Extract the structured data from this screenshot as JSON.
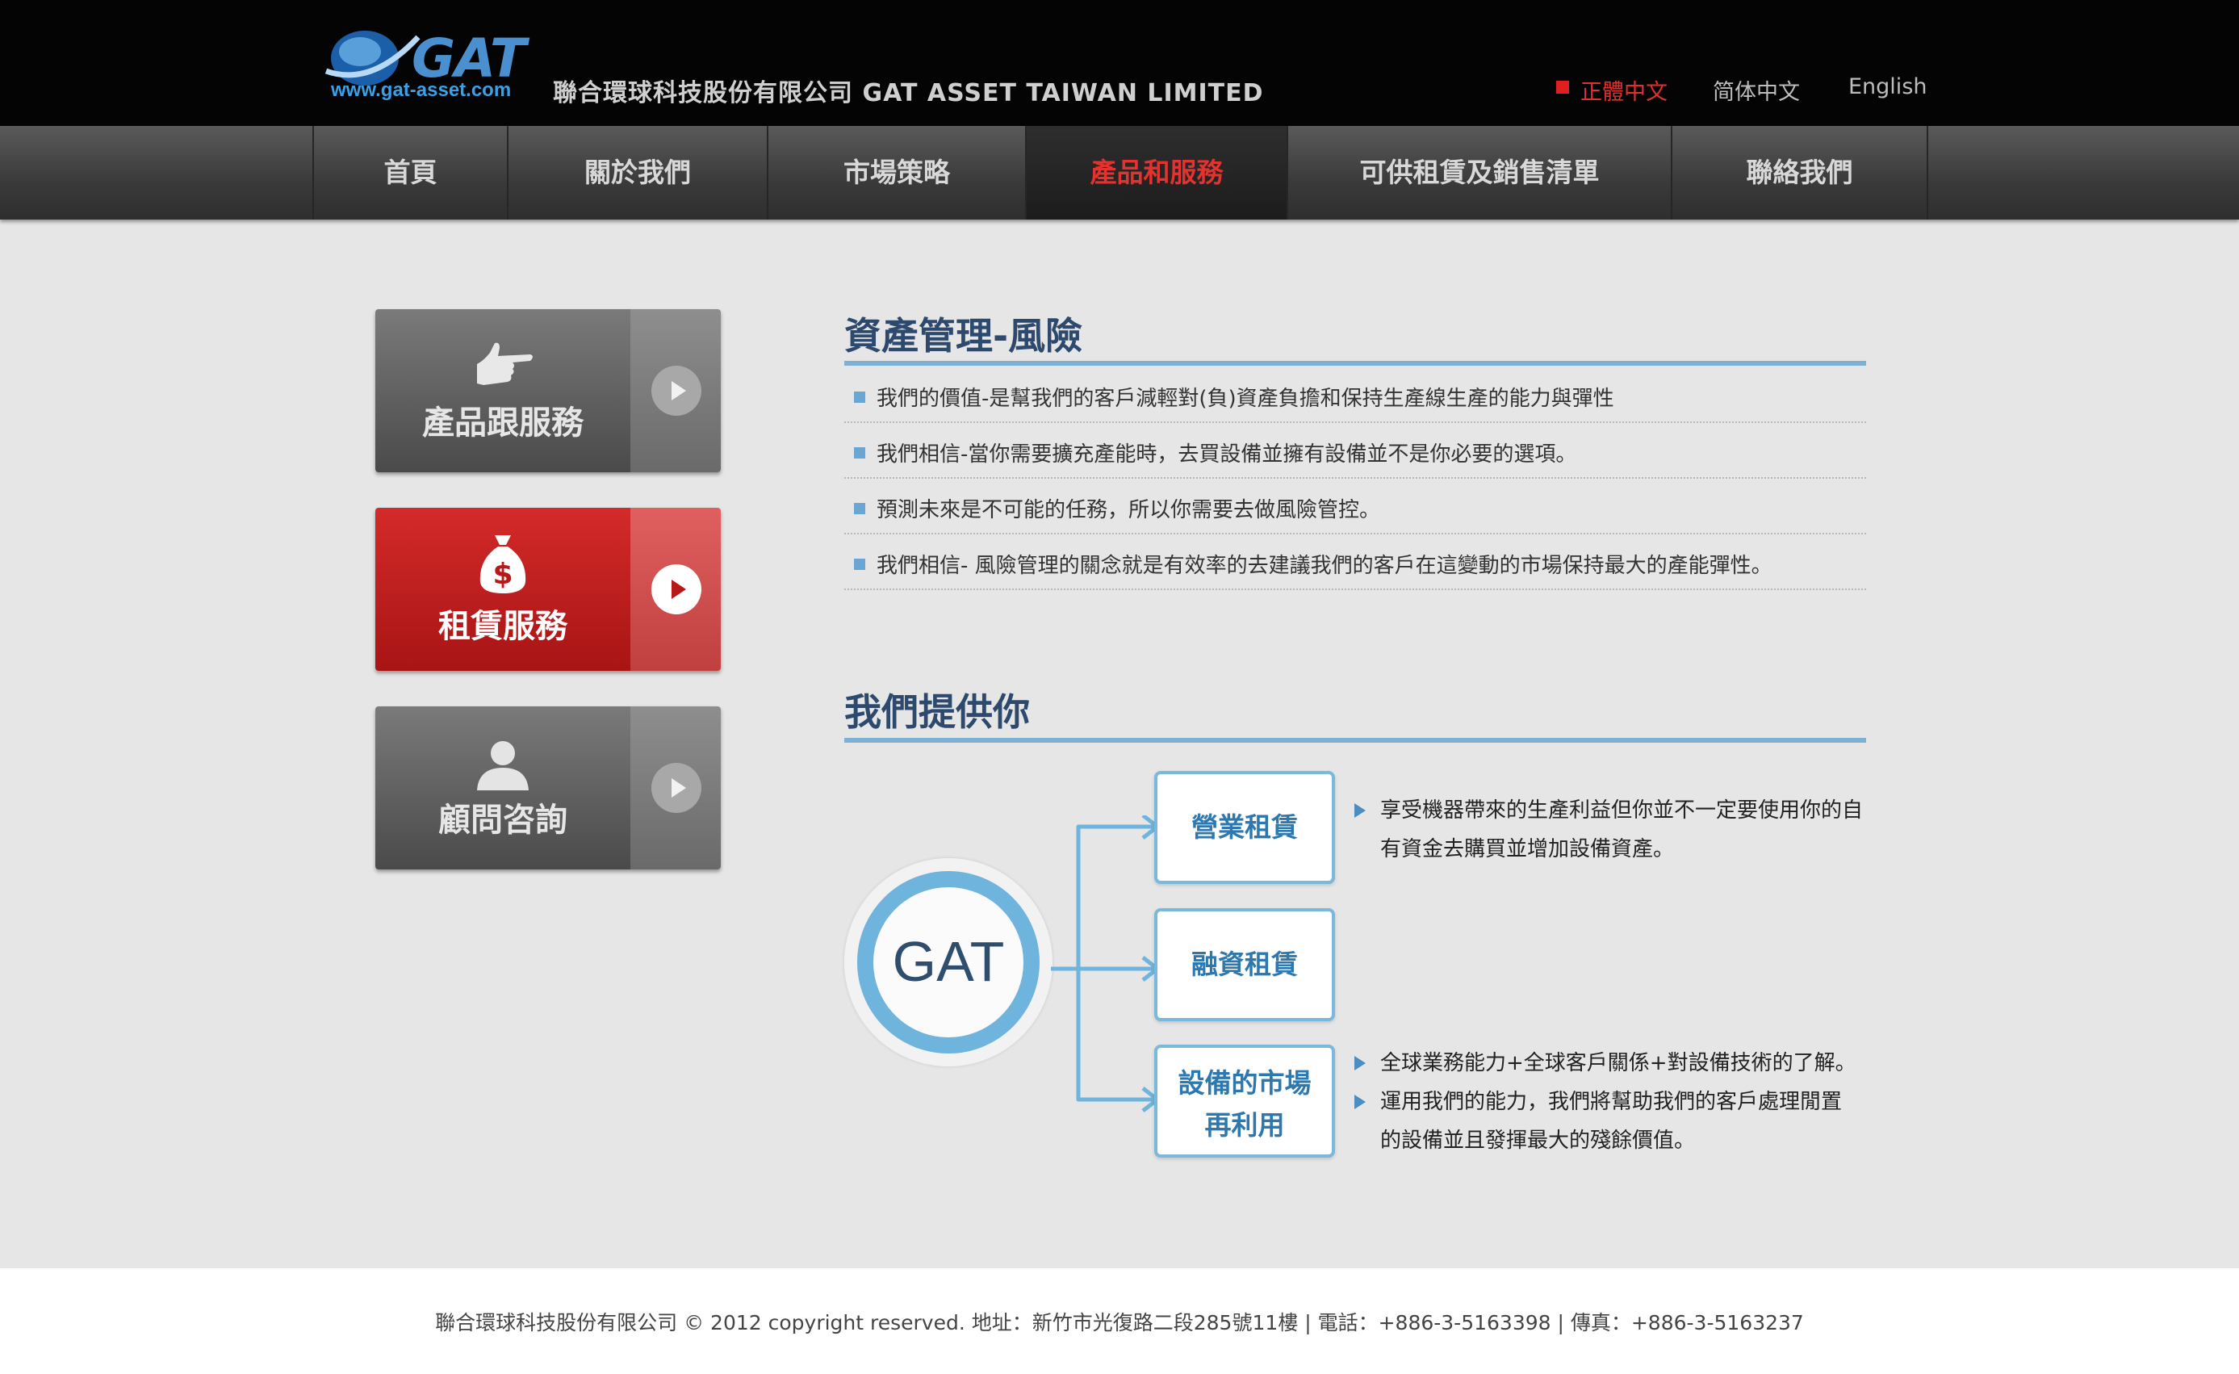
{
  "header": {
    "logo_text": "GAT",
    "logo_url": "www.gat-asset.com",
    "company_name": "聯合環球科技股份有限公司  GAT ASSET TAIWAN LIMITED",
    "languages": [
      "正體中文",
      "简体中文",
      "English"
    ],
    "active_language": "正體中文"
  },
  "nav": {
    "items": [
      "首頁",
      "關於我們",
      "市場策略",
      "產品和服務",
      "可供租賃及銷售清單",
      "聯絡我們"
    ],
    "active": "產品和服務"
  },
  "sidebar": {
    "buttons": [
      {
        "label": "產品跟服務",
        "icon": "pointing-hand-icon",
        "style": "gray"
      },
      {
        "label": "租賃服務",
        "icon": "money-bag-icon",
        "style": "red"
      },
      {
        "label": "顧問咨詢",
        "icon": "person-icon",
        "style": "gray"
      }
    ]
  },
  "risk": {
    "title": "資產管理-風險",
    "items": [
      "我們的價值-是幫我們的客戶減輕對(負)資產負擔和保持生產線生產的能力與彈性",
      "我們相信-當你需要擴充產能時，去買設備並擁有設備並不是你必要的選項。",
      "預測未來是不可能的任務，所以你需要去做風險管控。",
      "我們相信- 風險管理的關念就是有效率的去建議我們的客戶在這變動的市場保持最大的產能彈性。"
    ]
  },
  "offer": {
    "title": "我們提供你",
    "center_label": "GAT",
    "services": [
      "營業租賃",
      "融資租賃",
      "設備的市場再利用"
    ],
    "service3_lines": [
      "設備的市場",
      "再利用"
    ],
    "desc1_lines": [
      "享受機器帶來的生產利益但你並不一定要使用你的自",
      "有資金去購買並增加設備資產。"
    ],
    "desc2_line1": "全球業務能力+全球客戶關係+對設備技術的了解。",
    "desc2_lines": [
      "運用我們的能力，我們將幫助我們的客戶處理閒置",
      "的設備並且發揮最大的殘餘價值。"
    ]
  },
  "footer": {
    "text": "聯合環球科技股份有限公司 © 2012 copyright reserved. 地址：新竹市光復路二段285號11樓 | 電話：+886-3-5163398 | 傳真：+886-3-5163237"
  },
  "colors": {
    "accent_red": "#e4322f",
    "accent_blue": "#7eb0d4",
    "title_navy": "#2d4a6e"
  }
}
